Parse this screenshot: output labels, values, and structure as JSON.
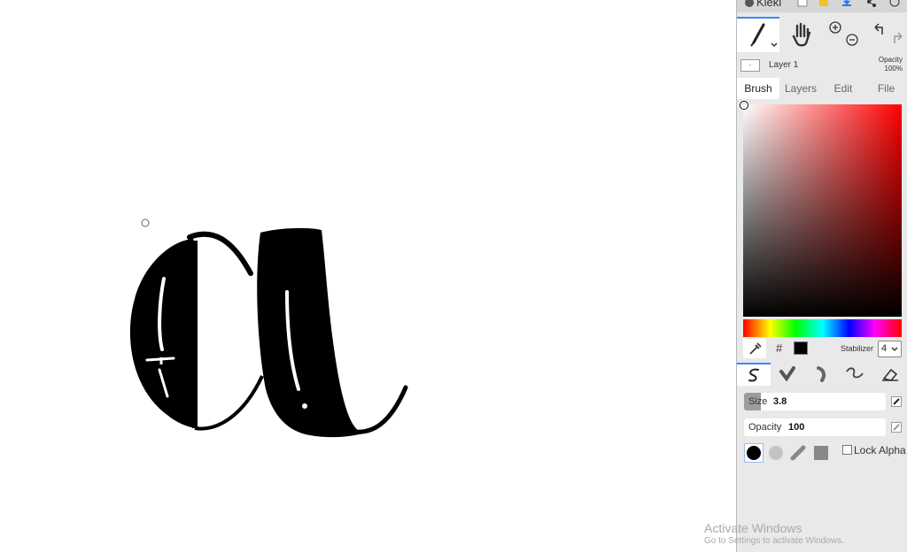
{
  "app": {
    "title": "Kleki"
  },
  "layer": {
    "name": "Layer 1",
    "opacity_label": "Opacity",
    "opacity_value": "100%",
    "thumb_text": "·"
  },
  "tabs": [
    {
      "label": "Brush",
      "active": true
    },
    {
      "label": "Layers",
      "active": false
    },
    {
      "label": "Edit",
      "active": false
    },
    {
      "label": "File",
      "active": false
    }
  ],
  "color": {
    "current": "#000000",
    "hue": "#ff0000",
    "hash_label": "#"
  },
  "stabilizer": {
    "label": "Stabilizer",
    "value": "4"
  },
  "brush": {
    "size_label": "Size",
    "size_value": "3.8",
    "size_fraction": 0.12,
    "opacity_label": "Opacity",
    "opacity_value": "100"
  },
  "lock_alpha": {
    "label": "Lock Alpha",
    "checked": false
  },
  "watermark": {
    "line1": "Activate Windows",
    "line2": "Go to Settings to activate Windows."
  },
  "colors": {
    "accent": "#3a88ff",
    "panel_bg": "#e9e9e9"
  },
  "icons": {
    "toolbar": [
      "brush-icon",
      "hand-icon",
      "zoom-in-icon",
      "zoom-out-icon",
      "undo-icon",
      "redo-icon"
    ],
    "brushes": [
      "pen-brush-icon",
      "blend-brush-icon",
      "sketchy-brush-icon",
      "smooth-brush-icon",
      "eraser-icon"
    ]
  }
}
